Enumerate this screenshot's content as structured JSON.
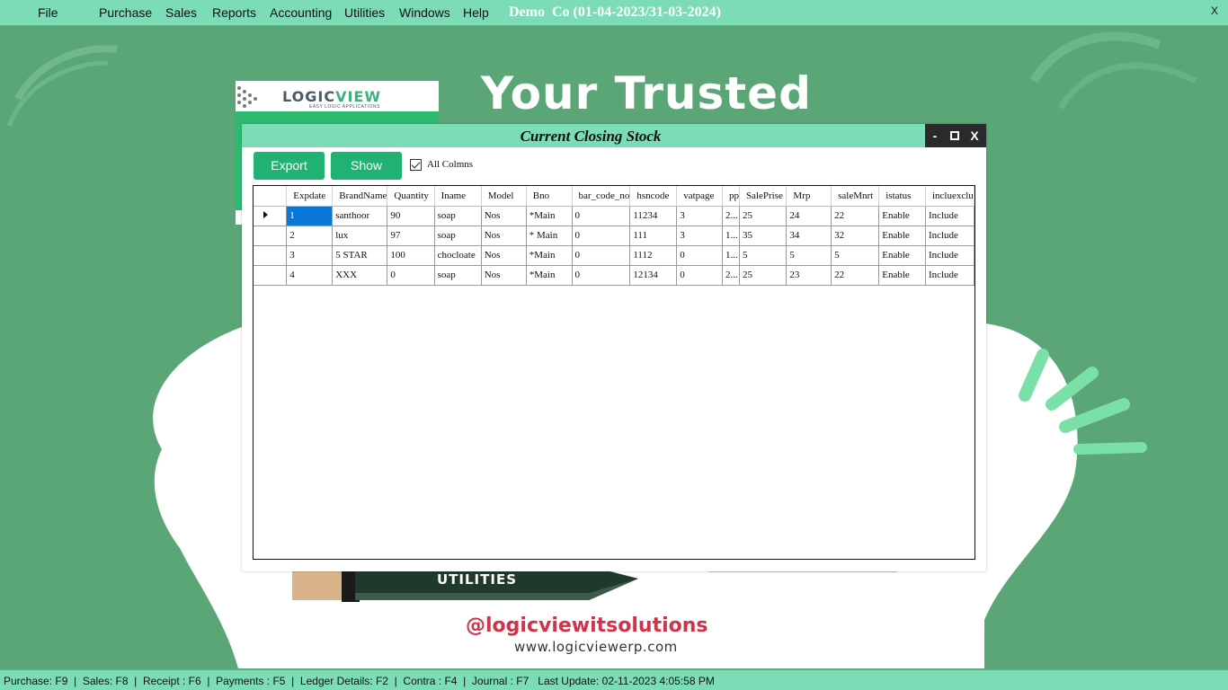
{
  "menubar": {
    "items": [
      "File",
      "Purchase",
      "Sales",
      "Reports",
      "Accounting",
      "Utilities",
      "Windows",
      "Help"
    ],
    "title": "Demo  Co (01-04-2023/31-03-2024)",
    "close_label": "X"
  },
  "desktop": {
    "hero_text": "Your Trusted",
    "logo_text_1": "LOGIC",
    "logo_text_2": "VIEW",
    "logo_sub": "EASY LOGIC APPLICATIONS",
    "utilities_label": "UTILITIES",
    "social_handle": "@logicviewitsolutions",
    "website": "www.logicviewerp.com"
  },
  "dialog": {
    "title": "Current Closing Stock",
    "min_label": "-",
    "close_label": "X",
    "export_label": "Export",
    "show_label": "Show",
    "all_columns_label": "All Colmns",
    "all_columns_checked": true
  },
  "grid": {
    "columns": [
      "Expdate",
      "BrandName",
      "Quantity",
      "Iname",
      "Model",
      "Bno",
      "bar_code_no",
      "hsncode",
      "vatpage",
      "pp",
      "SalePrise",
      "Mrp",
      "saleMnrt",
      "istatus",
      "incluexclu"
    ],
    "rows": [
      [
        "1",
        "santhoor",
        "90",
        "soap",
        "Nos",
        "*Main",
        "0",
        "11234",
        "3",
        "2...",
        "25",
        "24",
        "22",
        "Enable",
        "Include"
      ],
      [
        "2",
        "lux",
        "97",
        "soap",
        "Nos",
        "* Main",
        "0",
        "111",
        "3",
        "1...",
        "35",
        "34",
        "32",
        "Enable",
        "Include"
      ],
      [
        "3",
        "5 STAR",
        "100",
        "chocloate",
        "Nos",
        "*Main",
        "0",
        "1112",
        "0",
        "1...",
        "5",
        "5",
        "5",
        "Enable",
        "Include"
      ],
      [
        "4",
        "XXX",
        "0",
        "soap",
        "Nos",
        "*Main",
        "0",
        "12134",
        "0",
        "2...",
        "25",
        "23",
        "22",
        "Enable",
        "Include"
      ]
    ]
  },
  "statusbar": {
    "text": "Purchase: F9  |  Sales: F8  |  Receipt : F6  |  Payments : F5  |  Ledger Details: F2  |  Contra : F4  |  Journal : F7   Last Update: 02-11-2023 4:05:58 PM"
  },
  "colors": {
    "accent": "#7bdcb5",
    "desktop_bg": "#5aa676",
    "button": "#1fb272",
    "selection": "#0a78d7"
  }
}
